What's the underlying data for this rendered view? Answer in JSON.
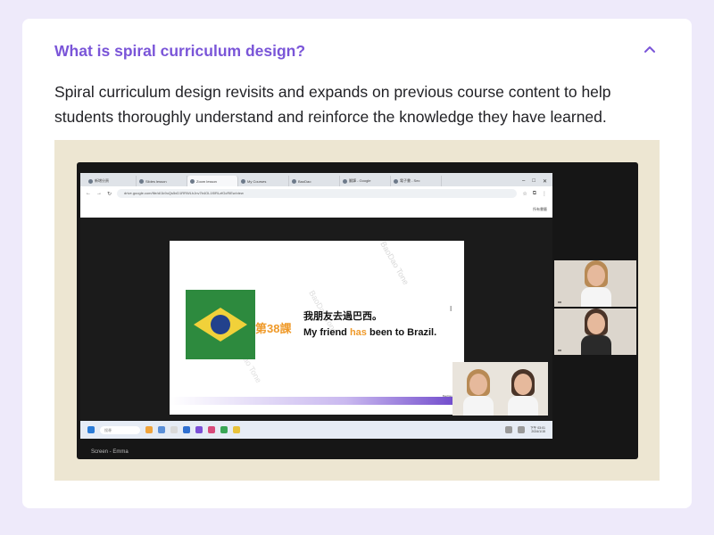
{
  "faq": {
    "question": "What is spiral curriculum design?",
    "answer": "Spiral curriculum design revisits and expands on previous course content to help students thoroughly understand and reinforce the knowledge they have learned.",
    "expanded": true,
    "accent_color": "#7a55d8",
    "chevron_icon": "chevron-up-icon"
  },
  "screenshot": {
    "browser": {
      "tabs": [
        "新增分頁",
        "Slides lesson",
        "Zoom lesson",
        "My Courses",
        "BaoDao",
        "翻譯 - Google",
        "電子書 - Sec",
        ""
      ],
      "url": "drive.google.com/file/d/1k9oQs5xD1RRWLhJnv7b4OL1f0RLzfGcRiEw/view",
      "bookmark_folder": "所有書籤"
    },
    "slide": {
      "lesson_label": "第38課",
      "sentence_zh": "我朋友去過巴西。",
      "sentence_en_before": "My friend ",
      "sentence_en_highlight": "has",
      "sentence_en_after": " been to Brazil.",
      "watermark": "BaoDao Tone",
      "brand": "BaoDao Tone"
    },
    "taskbar": {
      "search_placeholder": "搜尋",
      "time": "下午 03:01",
      "date": "2024/1/15"
    },
    "screen_label": "Screen - Emma"
  }
}
